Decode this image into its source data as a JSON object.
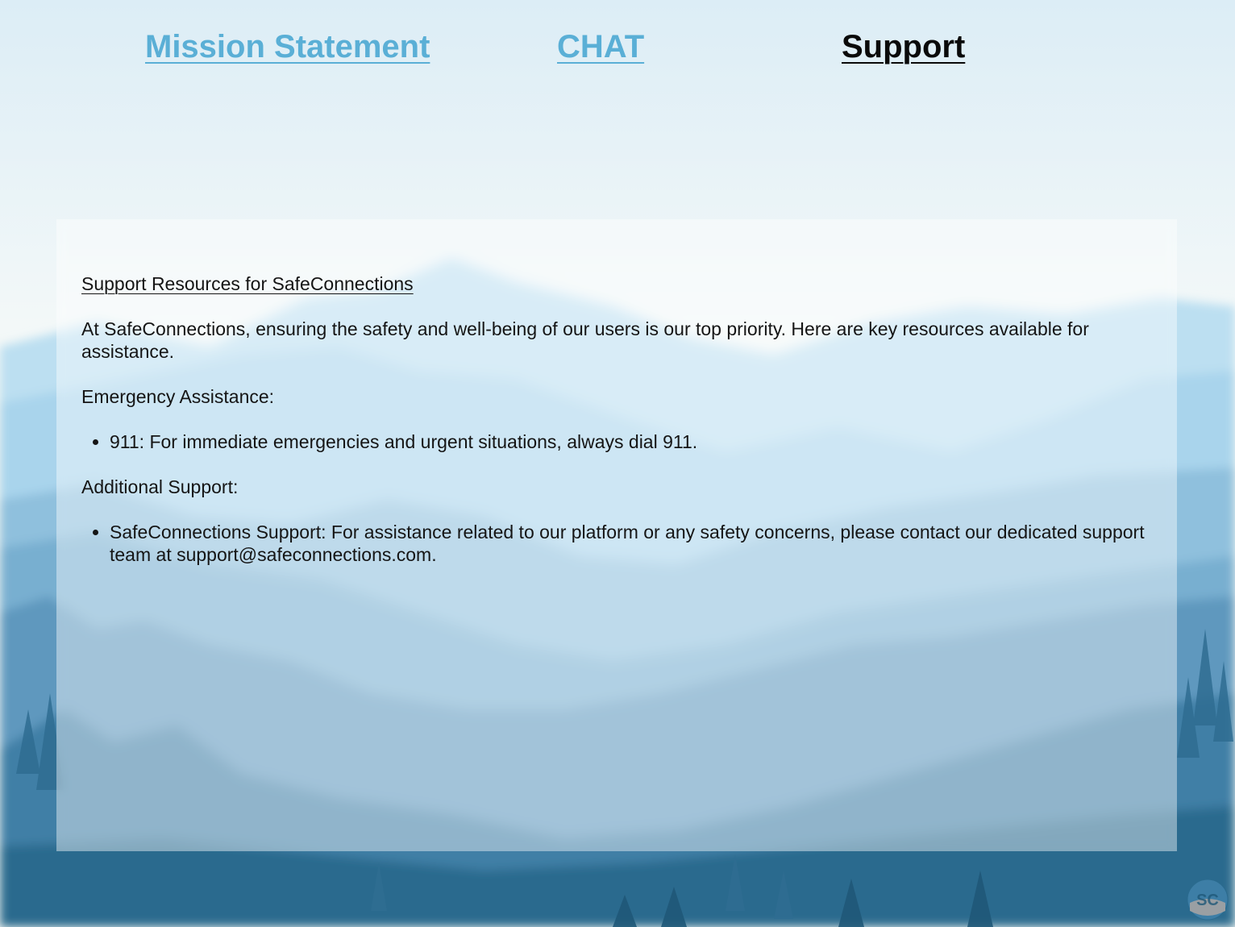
{
  "nav": {
    "mission_label": "Mission Statement",
    "chat_label": "CHAT",
    "support_label": "Support",
    "active": "Support"
  },
  "content": {
    "title": "Support Resources for SafeConnections",
    "intro": "At SafeConnections, ensuring the safety and well-being of our users is our top priority. Here are key resources available for assistance.",
    "emergency_heading": "Emergency Assistance:",
    "emergency_items": [
      "911: For immediate emergencies and urgent situations, always dial 911."
    ],
    "additional_heading": "Additional Support:",
    "additional_items": [
      "SafeConnections Support: For assistance related to our platform or any safety concerns, please contact our dedicated support team at support@safeconnections.com."
    ]
  },
  "colors": {
    "link": "#5aafd6",
    "active_link": "#0a0a0a",
    "sky": "#e6f2f8",
    "mountain_far": "#a8d3ea",
    "forest_dark": "#245f80"
  },
  "icons": {
    "logo": "sc-logo-icon"
  }
}
